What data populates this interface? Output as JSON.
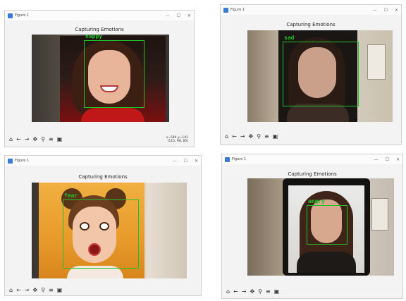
{
  "windows": [
    {
      "title": "Figure 1",
      "plot_title": "Capturing Emotions",
      "emotion": "happy",
      "coords": [
        "x=584 y=141",
        "[115, 98, 85]"
      ]
    },
    {
      "title": "Figure 1",
      "plot_title": "Capturing Emotions",
      "emotion": "sad"
    },
    {
      "title": "Figure 1",
      "plot_title": "Capturing Emotions",
      "emotion": "fear"
    },
    {
      "title": "Figure 1",
      "plot_title": "Capturing Emotions",
      "emotion": "angry"
    }
  ],
  "toolbar_icons": [
    "home-icon",
    "back-icon",
    "forward-icon",
    "pan-icon",
    "zoom-icon",
    "configure-icon",
    "save-icon"
  ],
  "colors": {
    "detection_box": "#22c12a"
  }
}
